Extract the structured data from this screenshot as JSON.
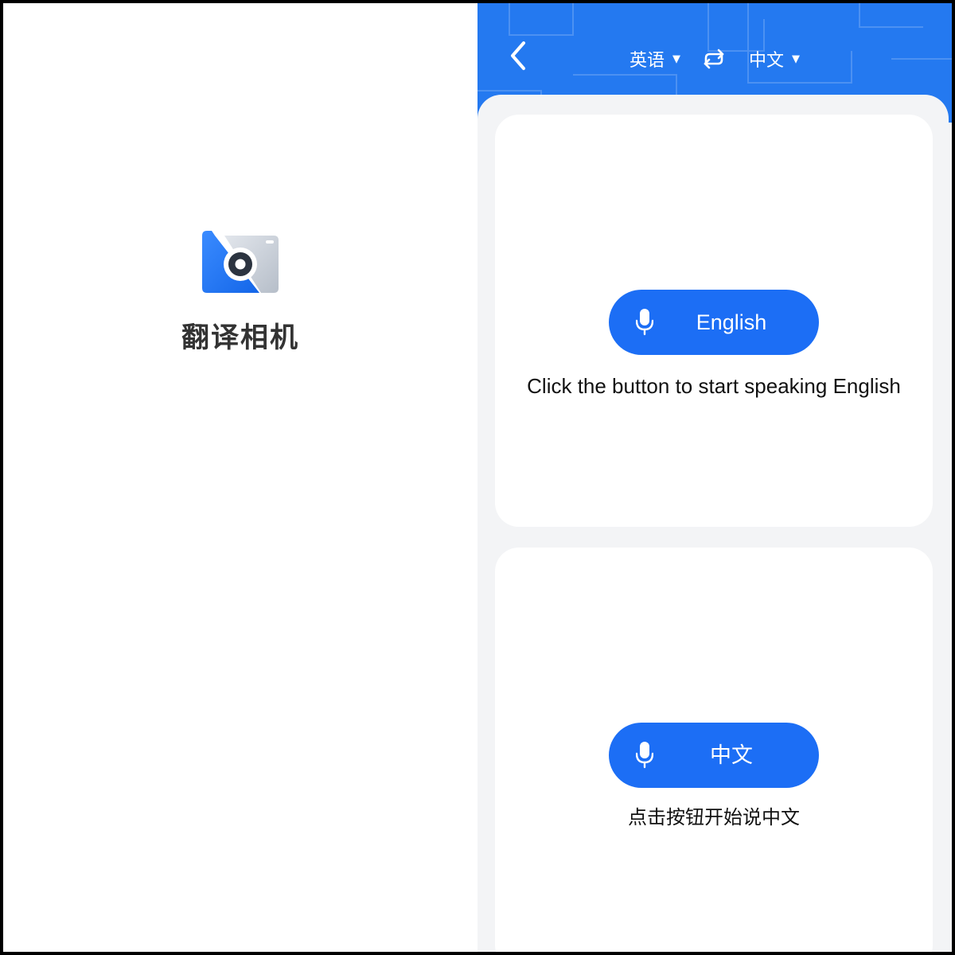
{
  "splash": {
    "app_name": "翻译相机",
    "logo_icon": "camera-translate-logo-icon"
  },
  "header": {
    "back_icon": "chevron-left-icon",
    "source_language": "英语",
    "target_language": "中文",
    "swap_icon": "swap-arrows-icon",
    "caret_icon": "caret-down-icon"
  },
  "cards": [
    {
      "button_label": "English",
      "hint": "Click the button to start speaking English",
      "mic_icon": "microphone-icon"
    },
    {
      "button_label": "中文",
      "hint": "点击按钮开始说中文",
      "mic_icon": "microphone-icon"
    }
  ],
  "colors": {
    "accent": "#1c6ef5",
    "header_bg": "#2479f0",
    "background": "#f3f4f6",
    "card": "#ffffff"
  }
}
